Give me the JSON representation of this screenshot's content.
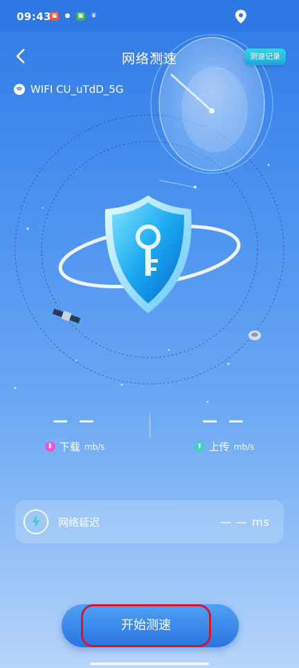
{
  "status_bar": {
    "time": "09:43"
  },
  "header": {
    "title": "网络测速",
    "history_label": "测速记录"
  },
  "wifi": {
    "name": "WIFI CU_uTdD_5G"
  },
  "download": {
    "value": "— —",
    "label": "下载",
    "unit": "mb/s"
  },
  "upload": {
    "value": "— —",
    "label": "上传",
    "unit": "mb/s"
  },
  "latency": {
    "label": "网络延迟",
    "value": "— — ms"
  },
  "start_button": {
    "label": "开始测速"
  },
  "colors": {
    "accent": "#2a74e0",
    "highlight_border": "#d6142a",
    "download_icon": "#e75ad6",
    "upload_icon": "#3fd0c3"
  }
}
